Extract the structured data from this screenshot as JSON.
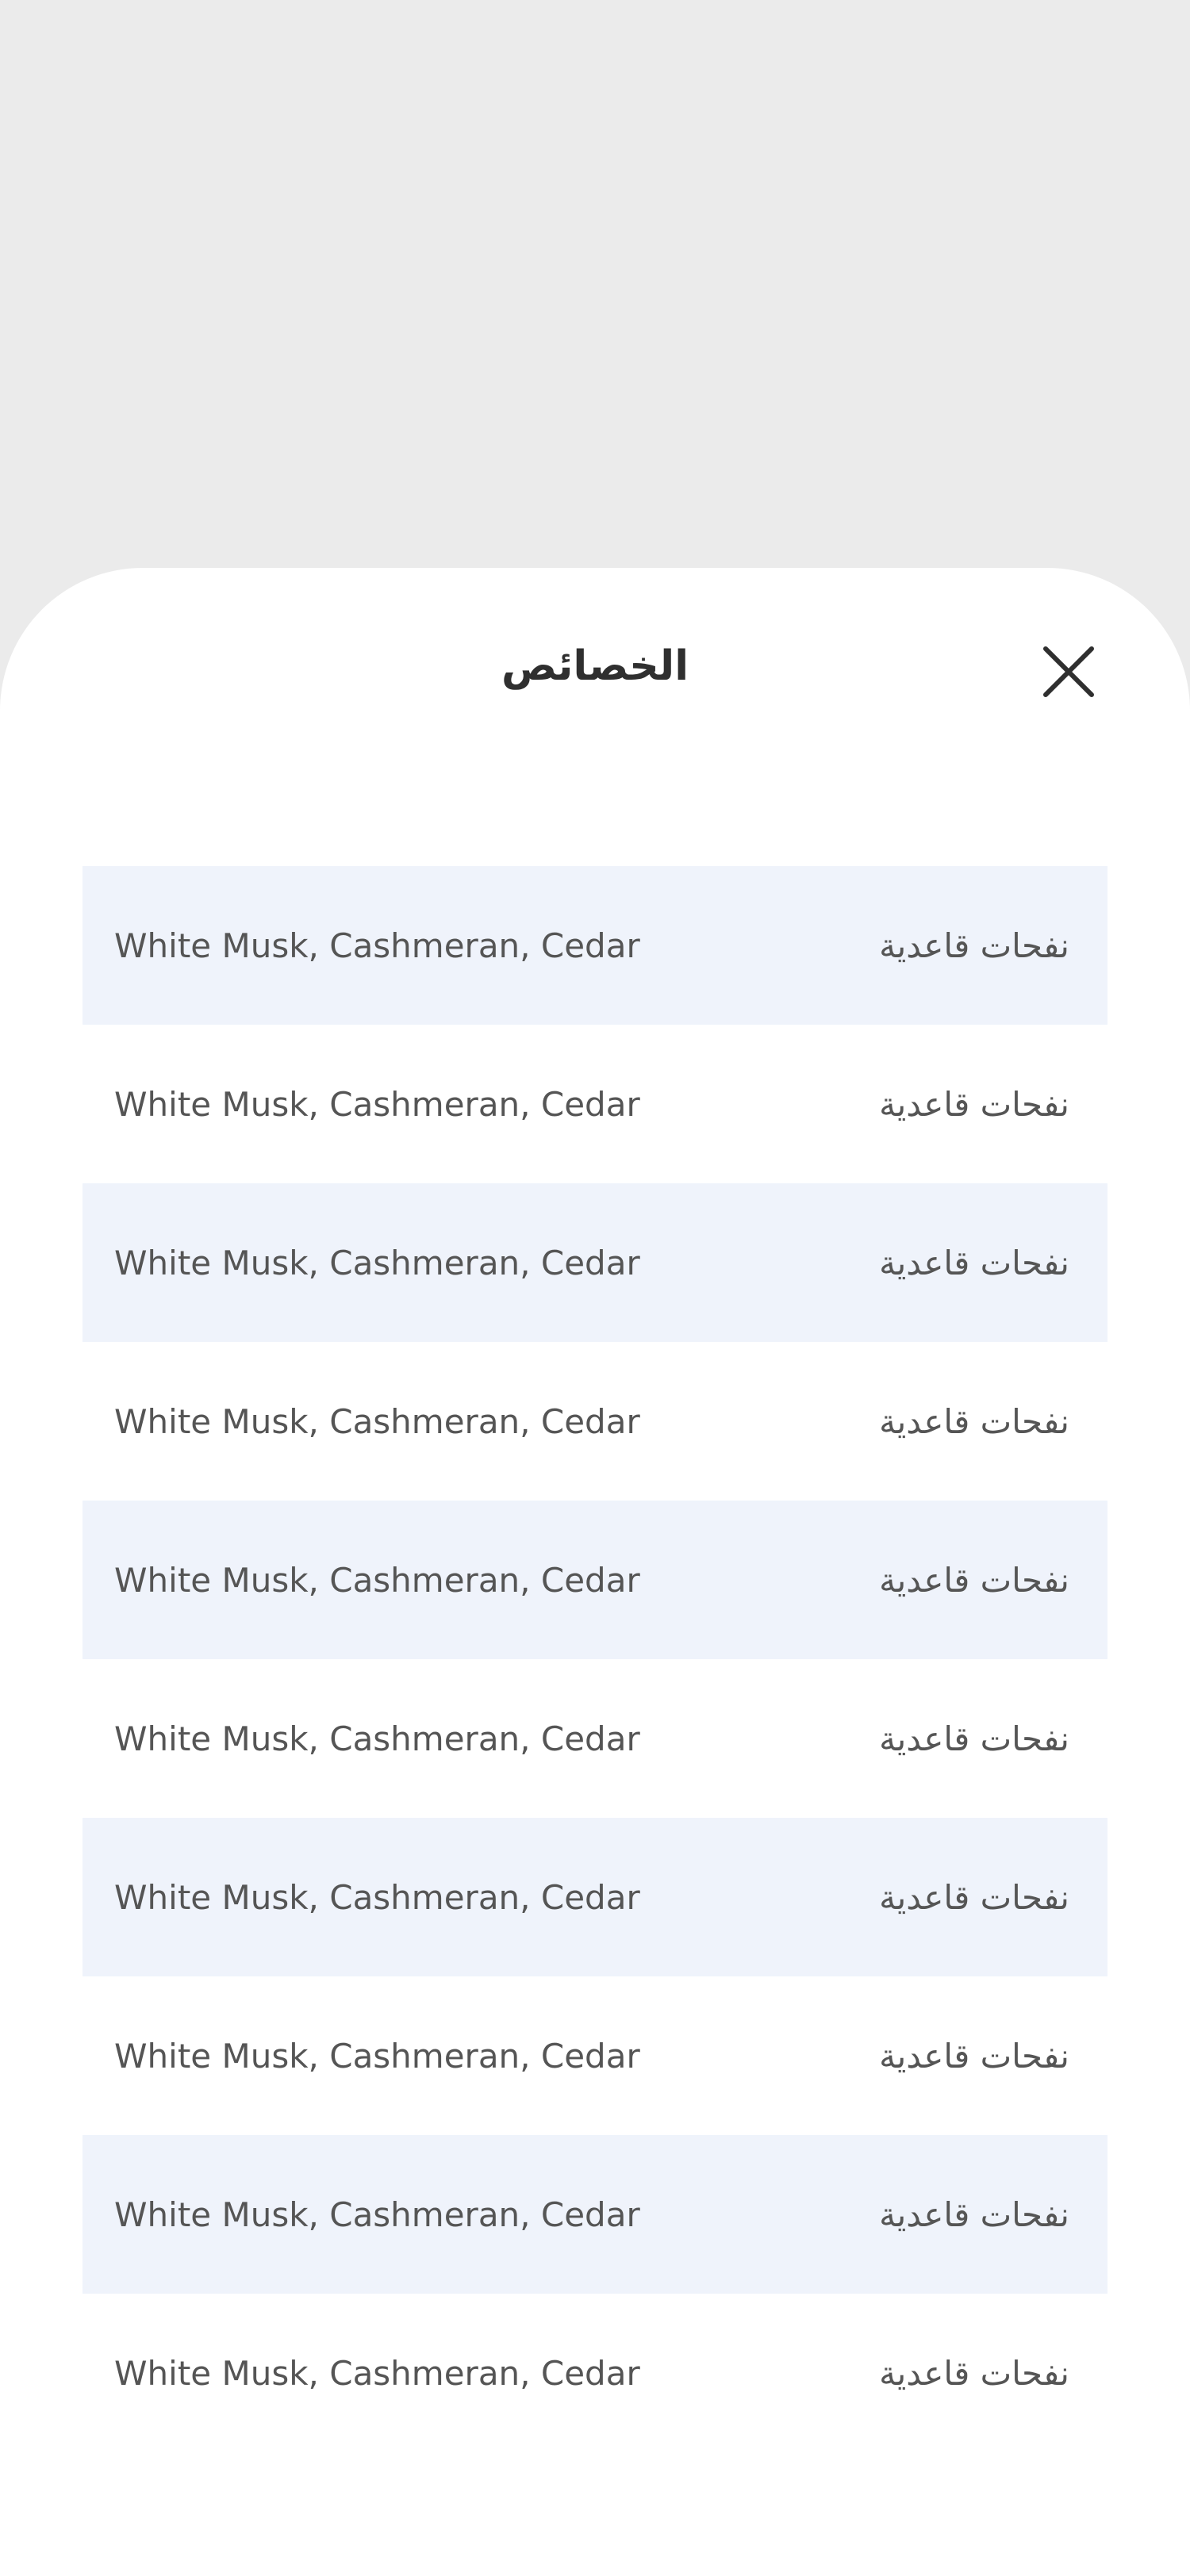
{
  "sheet": {
    "title": "الخصائص",
    "close_icon": "close-icon"
  },
  "attributes": [
    {
      "label": "نفحات قاعدية",
      "value": "White Musk, Cashmeran, Cedar"
    },
    {
      "label": "نفحات قاعدية",
      "value": "White Musk, Cashmeran, Cedar"
    },
    {
      "label": "نفحات قاعدية",
      "value": "White Musk, Cashmeran, Cedar"
    },
    {
      "label": "نفحات قاعدية",
      "value": "White Musk, Cashmeran, Cedar"
    },
    {
      "label": "نفحات قاعدية",
      "value": "White Musk, Cashmeran, Cedar"
    },
    {
      "label": "نفحات قاعدية",
      "value": "White Musk, Cashmeran, Cedar"
    },
    {
      "label": "نفحات قاعدية",
      "value": "White Musk, Cashmeran, Cedar"
    },
    {
      "label": "نفحات قاعدية",
      "value": "White Musk, Cashmeran, Cedar"
    },
    {
      "label": "نفحات قاعدية",
      "value": "White Musk, Cashmeran, Cedar"
    },
    {
      "label": "نفحات قاعدية",
      "value": "White Musk, Cashmeran, Cedar"
    }
  ],
  "colors": {
    "backdrop": "#ebebeb",
    "sheet": "#ffffff",
    "row_shaded": "#eff3fb",
    "text": "#555555",
    "title": "#2f2f2f"
  }
}
